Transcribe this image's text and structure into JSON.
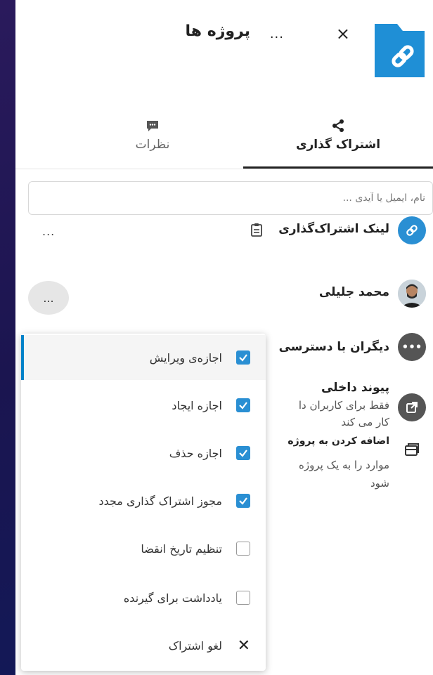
{
  "header": {
    "title": "پروژه ها",
    "more": "...",
    "close": "×"
  },
  "tabs": [
    {
      "label": "اشتراک گذاری",
      "icon": "share-icon",
      "active": true
    },
    {
      "label": "نظرات",
      "icon": "comment-icon",
      "active": false
    }
  ],
  "search": {
    "placeholder": "نام، ایمیل یا آیدی ..."
  },
  "shares": {
    "link": {
      "title": "لینک اشتراک‌گذاری",
      "more": "..."
    },
    "user": {
      "title": "محمد جلیلی",
      "more": "..."
    },
    "others": {
      "title": "دیگران با دسترسی"
    },
    "internal": {
      "title": "پیوند داخلی",
      "line1": "فقط برای کاربران دا",
      "line2": "کار می کند"
    },
    "project": {
      "title": "اضافه کردن به پروژه",
      "line1": "موارد را به یک پروژه",
      "line2": "شود"
    }
  },
  "menu": {
    "items": [
      {
        "label": "اجازه‌ی ویرایش",
        "checked": true
      },
      {
        "label": "اجازه ایجاد",
        "checked": true
      },
      {
        "label": "اجازه حذف",
        "checked": true
      },
      {
        "label": "مجوز اشتراک گذاری مجدد",
        "checked": true
      },
      {
        "label": "تنظیم تاریخ انقضا",
        "checked": false
      },
      {
        "label": "یادداشت برای گیرنده",
        "checked": false
      }
    ],
    "unshare": "لغو اشتراک"
  },
  "colors": {
    "accent": "#2a8fd3",
    "folder": "#1f8fd6"
  }
}
